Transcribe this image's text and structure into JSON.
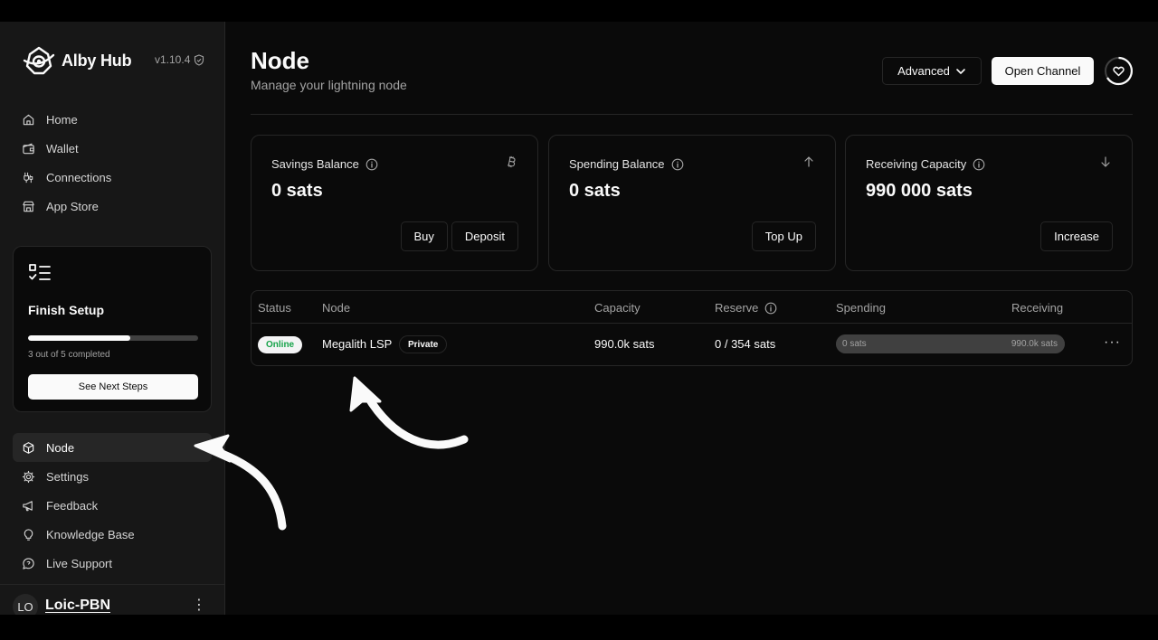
{
  "app": {
    "name": "Alby Hub",
    "version": "v1.10.4"
  },
  "sidebar": {
    "top_items": [
      {
        "label": "Home",
        "icon": "home-icon"
      },
      {
        "label": "Wallet",
        "icon": "wallet-icon"
      },
      {
        "label": "Connections",
        "icon": "connections-icon"
      },
      {
        "label": "App Store",
        "icon": "store-icon"
      }
    ],
    "setup": {
      "title": "Finish Setup",
      "progress_text": "3 out of 5 completed",
      "completed": 3,
      "total": 5,
      "button": "See Next Steps"
    },
    "bottom_items": [
      {
        "label": "Node",
        "icon": "box-icon",
        "active": true
      },
      {
        "label": "Settings",
        "icon": "gear-icon"
      },
      {
        "label": "Feedback",
        "icon": "megaphone-icon"
      },
      {
        "label": "Knowledge Base",
        "icon": "lightbulb-icon"
      },
      {
        "label": "Live Support",
        "icon": "chat-icon"
      }
    ],
    "user": {
      "initials": "LO",
      "name": "Loic-PBN"
    }
  },
  "header": {
    "title": "Node",
    "subtitle": "Manage your lightning node",
    "advanced_label": "Advanced",
    "open_channel_label": "Open Channel"
  },
  "cards": [
    {
      "title": "Savings Balance",
      "value": "0 sats",
      "corner_icon": "bitcoin-icon",
      "actions": [
        "Buy",
        "Deposit"
      ]
    },
    {
      "title": "Spending Balance",
      "value": "0 sats",
      "corner_icon": "arrow-up-icon",
      "actions": [
        "Top Up"
      ]
    },
    {
      "title": "Receiving Capacity",
      "value": "990 000 sats",
      "corner_icon": "arrow-down-icon",
      "actions": [
        "Increase"
      ]
    }
  ],
  "channels": {
    "columns": [
      "Status",
      "Node",
      "Capacity",
      "Reserve",
      "Spending",
      "Receiving"
    ],
    "rows": [
      {
        "status": "Online",
        "node": "Megalith LSP",
        "visibility": "Private",
        "capacity": "990.0k sats",
        "reserve": "0 / 354 sats",
        "spending": "0 sats",
        "receiving": "990.0k sats",
        "spending_fraction": 0.0
      }
    ]
  },
  "colors": {
    "online": "#16a34a",
    "background": "#0a0a0a",
    "sidebar": "#171717"
  }
}
